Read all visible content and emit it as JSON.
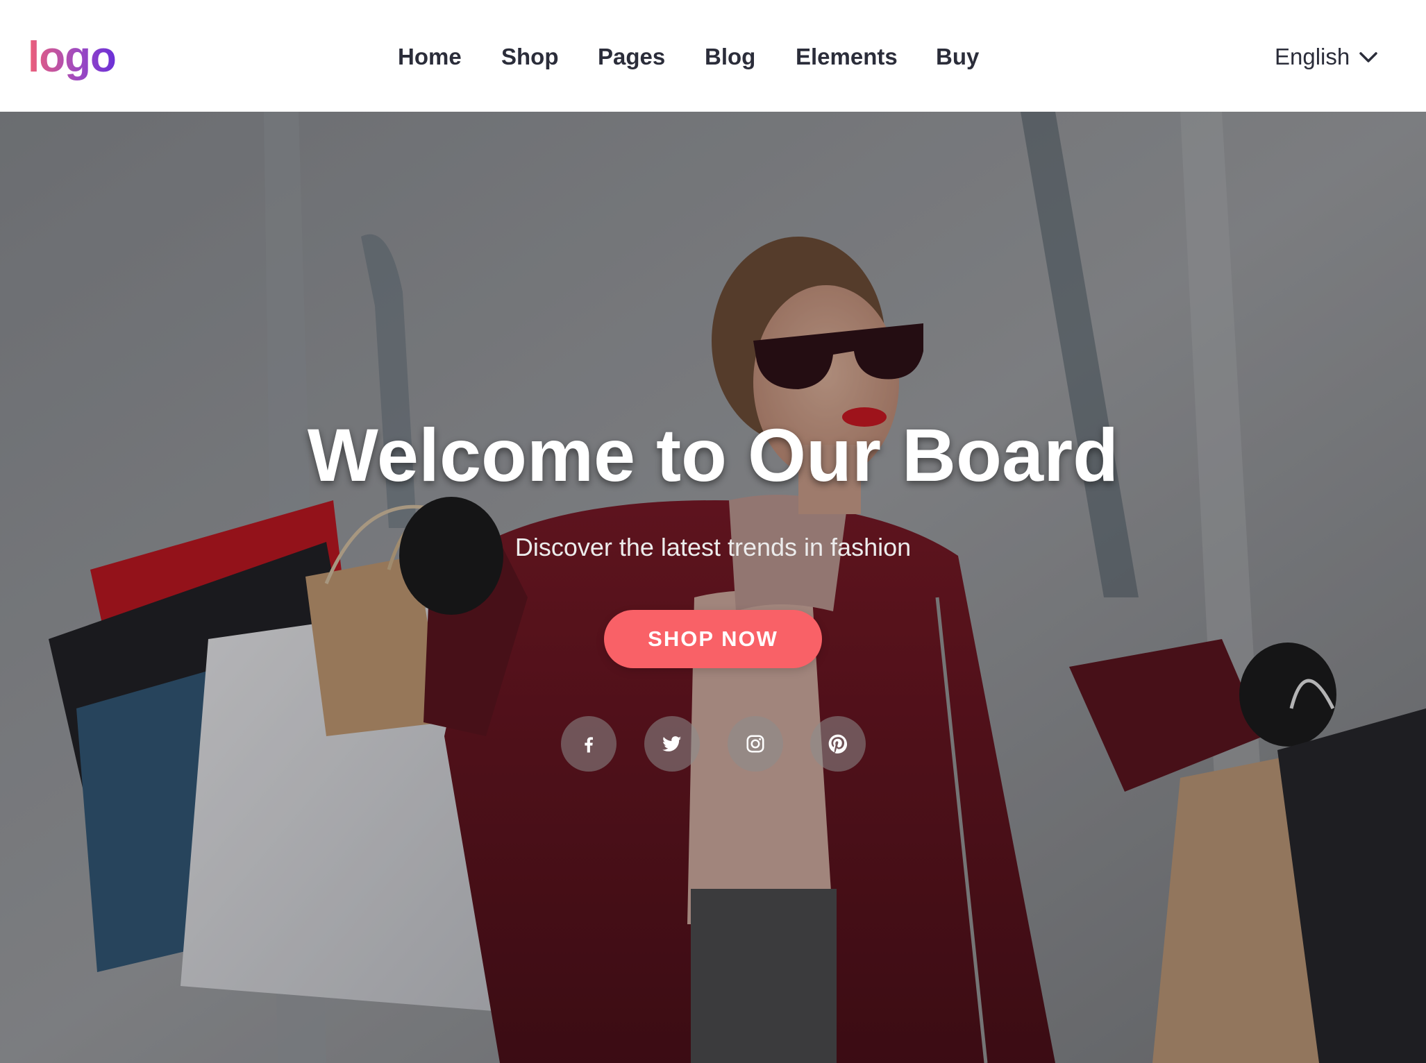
{
  "header": {
    "logo_text": "logo",
    "nav": [
      {
        "label": "Home"
      },
      {
        "label": "Shop"
      },
      {
        "label": "Pages"
      },
      {
        "label": "Blog"
      },
      {
        "label": "Elements"
      },
      {
        "label": "Buy"
      }
    ],
    "language": {
      "label": "English",
      "icon": "chevron-down-icon"
    }
  },
  "hero": {
    "title": "Welcome to Our Board",
    "subtitle": "Discover the latest trends in fashion",
    "cta_label": "SHOP NOW",
    "social_icons": [
      "facebook-icon",
      "twitter-icon",
      "instagram-icon",
      "pinterest-icon"
    ]
  },
  "colors": {
    "accent": "#f96167",
    "nav_text": "#2b2d3a",
    "logo_gradient_start": "#ee5f78",
    "logo_gradient_end": "#6a2fd8",
    "header_bg": "#ffffff"
  }
}
